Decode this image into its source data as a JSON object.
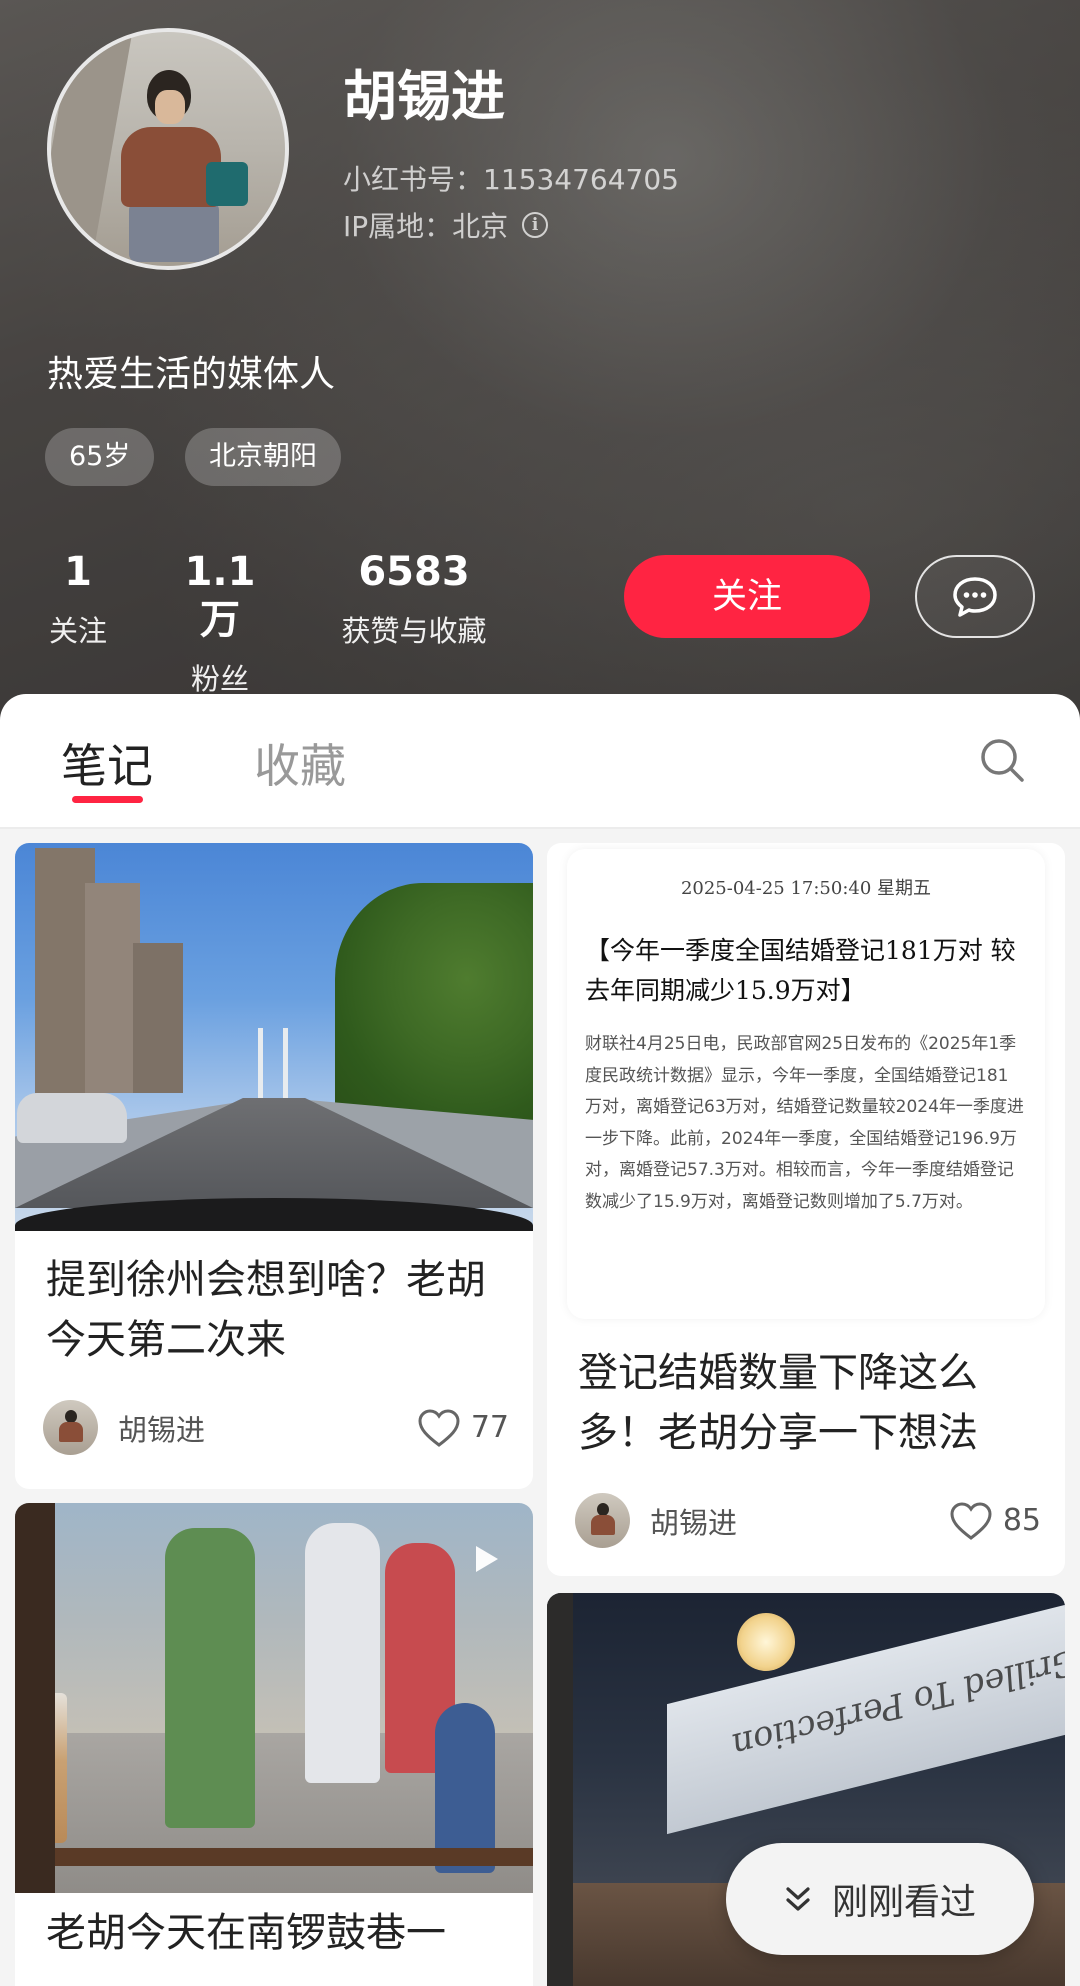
{
  "profile": {
    "name": "胡锡进",
    "xhs_id": "小红书号：11534764705",
    "ip_location": "IP属地：北京",
    "bio": "热爱生活的媒体人",
    "tags": [
      "65岁",
      "北京朝阳"
    ],
    "stats": [
      {
        "value": "1",
        "label": "关注"
      },
      {
        "value": "1.1万",
        "label": "粉丝"
      },
      {
        "value": "6583",
        "label": "获赞与收藏"
      }
    ],
    "follow_label": "关注",
    "icons": {
      "info": "info-icon",
      "message": "chat-bubble-icon"
    }
  },
  "tabs": {
    "notes": "笔记",
    "collections": "收藏",
    "active": "notes",
    "accent_color": "#ff2442"
  },
  "notes": [
    {
      "title": "提到徐州会想到啥？老胡今天第二次来",
      "author": "胡锡进",
      "likes": "77"
    },
    {
      "title": "登记结婚数量下降这么多！老胡分享一下想法",
      "author": "胡锡进",
      "likes": "85",
      "image_text": {
        "timestamp": "2025-04-25 17:50:40 星期五",
        "headline": "【今年一季度全国结婚登记181万对 较去年同期减少15.9万对】",
        "body": "财联社4月25日电，民政部官网25日发布的《2025年1季度民政统计数据》显示，今年一季度，全国结婚登记181万对，离婚登记63万对，结婚登记数量较2024年一季度进一步下降。此前，2024年一季度，全国结婚登记196.9万对，离婚登记57.3万对。相较而言，今年一季度结婚登记数减少了15.9万对，离婚登记数则增加了5.7万对。"
      }
    },
    {
      "title": "老胡今天在南锣鼓巷一"
    },
    {
      "image_text": "Grilled To Perfection"
    }
  ],
  "recently_viewed": "刚刚看过"
}
